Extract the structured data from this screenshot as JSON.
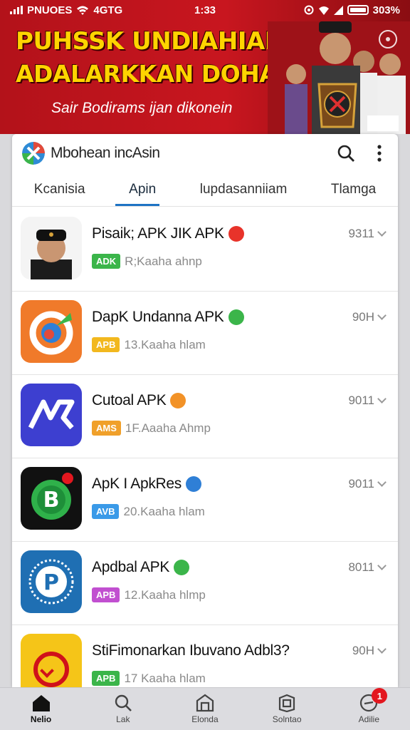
{
  "status_bar": {
    "carrier": "PNUOES",
    "network": "4GTG",
    "time": "1:33",
    "battery": "303%"
  },
  "banner": {
    "headline_1": "PUHSSK UNDIAHIAN",
    "headline_2": "ADALARKKAN DOHANIIII",
    "subline": "Sair Bodirams ijan dikonein"
  },
  "app_header": {
    "title": "Mbohean incAsin"
  },
  "tabs": [
    {
      "label": "Kcanisia",
      "active": false
    },
    {
      "label": "Apin",
      "active": true
    },
    {
      "label": "lupdasanniiam",
      "active": false
    },
    {
      "label": "Tlamga",
      "active": false
    }
  ],
  "apps": [
    {
      "title": "Pisaik; APK JIK APK",
      "tag": "ADK",
      "tag_color": "#3bb54a",
      "meta": "R;Kaaha ahnp",
      "size": "9311",
      "badge_color": "#e8332a"
    },
    {
      "title": "DapK Undanna APK",
      "tag": "APB",
      "tag_color": "#f2b81e",
      "meta": "13.Kaaha hlam",
      "size": "90H",
      "badge_color": "#3bb54a"
    },
    {
      "title": "Cutoal APK",
      "tag": "AMS",
      "tag_color": "#f0a02a",
      "meta": "1F.Aaaha Ahmp",
      "size": "9011",
      "badge_color": "#f29227"
    },
    {
      "title": "ApK I ApkRes",
      "tag": "AVB",
      "tag_color": "#3a9ae8",
      "meta": "20.Kaaha hlam",
      "size": "9011",
      "badge_color": "#2f7fd6"
    },
    {
      "title": "Apdbal APK",
      "tag": "APB",
      "tag_color": "#c14fd0",
      "meta": "12.Kaaha hlmp",
      "size": "8011",
      "badge_color": "#3bb54a"
    },
    {
      "title": "StiFimonarkan Ibuvano Adbl3?",
      "tag": "APB",
      "tag_color": "#3bb54a",
      "meta": "17 Kaaha hlam",
      "size": "90H",
      "badge_color": ""
    }
  ],
  "bottom_nav": [
    {
      "label": "Nelio",
      "icon": "home-icon",
      "active": true
    },
    {
      "label": "Lak",
      "icon": "search-icon",
      "active": false
    },
    {
      "label": "Elonda",
      "icon": "store-icon",
      "active": false
    },
    {
      "label": "Solntao",
      "icon": "box-icon",
      "active": false
    },
    {
      "label": "Adilie",
      "icon": "profile-icon",
      "active": false,
      "notification": "1"
    }
  ],
  "colors": {
    "banner_red": "#c8161f",
    "accent_blue": "#1e73c4",
    "headline_yellow": "#ffd400"
  }
}
